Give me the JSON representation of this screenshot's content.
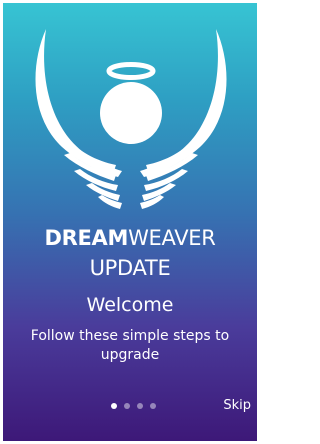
{
  "brand": {
    "name_bold": "DREAM",
    "name_light": "WEAVER",
    "subtitle": "UPDATE",
    "logo_icon": "angel-wings-halo-icon"
  },
  "onboarding": {
    "heading": "Welcome",
    "description": "Follow these simple steps to upgrade",
    "total_steps": 4,
    "current_step": 1,
    "skip_label": "Skip"
  },
  "colors": {
    "gradient_top": "#37c4d3",
    "gradient_bottom": "#3d1878",
    "text": "#ffffff"
  }
}
